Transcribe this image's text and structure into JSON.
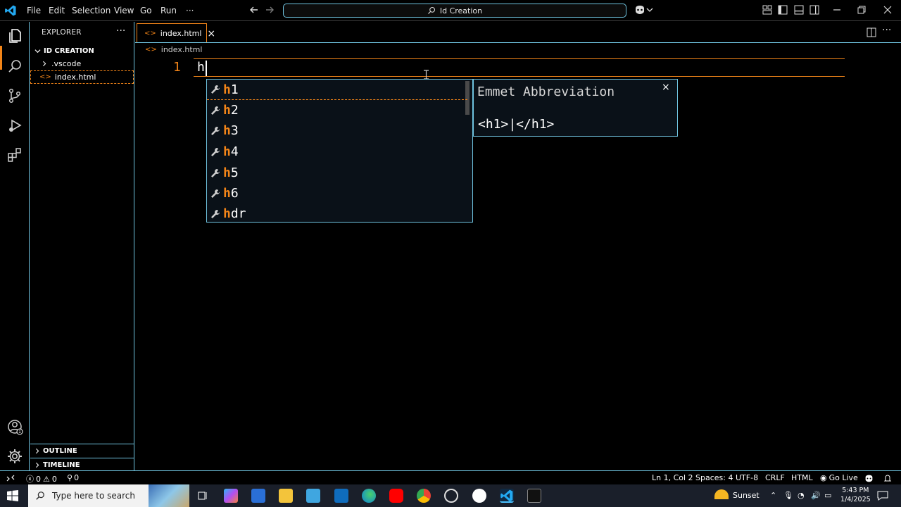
{
  "titlebar": {
    "menu": [
      "File",
      "Edit",
      "Selection",
      "View",
      "Go",
      "Run",
      "···"
    ],
    "command_center": "Id Creation"
  },
  "activitybar": {
    "icons": [
      "explorer-icon",
      "search-icon",
      "source-control-icon",
      "run-debug-icon",
      "extensions-icon",
      "accounts-icon",
      "settings-gear-icon"
    ],
    "accounts_badge": "1"
  },
  "sidebar": {
    "title": "EXPLORER",
    "more": "···",
    "folder": "ID CREATION",
    "items": [
      {
        "label": ".vscode",
        "type": "folder"
      },
      {
        "label": "index.html",
        "type": "file"
      }
    ],
    "outline": "OUTLINE",
    "timeline": "TIMELINE"
  },
  "tabs": [
    {
      "label": "index.html",
      "active": true,
      "close": "×"
    }
  ],
  "breadcrumb": "index.html",
  "editor": {
    "line_number": "1",
    "line_text": "h"
  },
  "suggest": {
    "typed": "h",
    "items": [
      {
        "match": "h",
        "rest": "1"
      },
      {
        "match": "h",
        "rest": "2"
      },
      {
        "match": "h",
        "rest": "3"
      },
      {
        "match": "h",
        "rest": "4"
      },
      {
        "match": "h",
        "rest": "5"
      },
      {
        "match": "h",
        "rest": "6"
      },
      {
        "match": "h",
        "rest": "dr"
      }
    ]
  },
  "details": {
    "title": "Emmet Abbreviation",
    "code": "<h1>|</h1>",
    "close": "×"
  },
  "statusbar": {
    "errors": "0",
    "warnings": "0",
    "ports": "0",
    "position": "Ln 1, Col 2",
    "spaces": "Spaces: 4",
    "encoding": "UTF-8",
    "eol": "CRLF",
    "language": "HTML",
    "golive": "Go Live"
  },
  "taskbar": {
    "search_placeholder": "Type here to search",
    "weather": "Sunset",
    "time": "5:43 PM",
    "date": "1/4/2025"
  },
  "colors": {
    "accent_orange": "#f38518",
    "border_cyan": "#6fc3df",
    "vscode_blue": "#23a9f2"
  }
}
